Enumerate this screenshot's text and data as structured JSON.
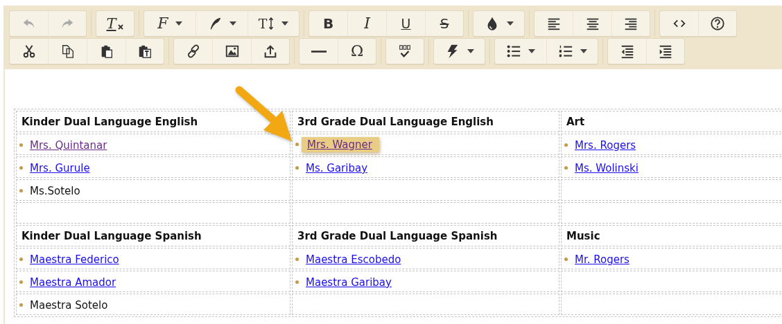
{
  "toolbar": {
    "rows": [
      {
        "groups": [
          {
            "buttons": [
              {
                "kind": "undo",
                "disabled": true,
                "dropdown": false
              },
              {
                "kind": "redo",
                "disabled": true,
                "dropdown": false
              }
            ]
          },
          {
            "buttons": [
              {
                "kind": "clear-format",
                "glyph": "T",
                "disabled": false,
                "dropdown": false
              }
            ]
          },
          {
            "buttons": [
              {
                "kind": "font",
                "glyph": "F",
                "disabled": false,
                "dropdown": true
              },
              {
                "kind": "pen",
                "disabled": false,
                "dropdown": true
              },
              {
                "kind": "font-size",
                "glyph": "T",
                "disabled": false,
                "dropdown": true
              }
            ]
          },
          {
            "buttons": [
              {
                "kind": "bold",
                "glyph": "B",
                "disabled": false,
                "dropdown": false
              },
              {
                "kind": "italic",
                "glyph": "I",
                "disabled": false,
                "dropdown": false
              },
              {
                "kind": "underline",
                "glyph": "U",
                "disabled": false,
                "dropdown": false
              },
              {
                "kind": "strike",
                "glyph": "S",
                "disabled": false,
                "dropdown": false
              }
            ]
          },
          {
            "buttons": [
              {
                "kind": "color",
                "disabled": false,
                "dropdown": true
              }
            ]
          },
          {
            "buttons": [
              {
                "kind": "align-left",
                "disabled": false,
                "dropdown": false
              },
              {
                "kind": "align-center",
                "disabled": false,
                "dropdown": false
              },
              {
                "kind": "align-right",
                "disabled": false,
                "dropdown": false
              }
            ]
          },
          {
            "buttons": [
              {
                "kind": "code",
                "disabled": false,
                "dropdown": false
              },
              {
                "kind": "help",
                "disabled": false,
                "dropdown": false
              }
            ]
          }
        ]
      },
      {
        "groups": [
          {
            "buttons": [
              {
                "kind": "cut",
                "disabled": false,
                "dropdown": false
              },
              {
                "kind": "copy",
                "disabled": false,
                "dropdown": false
              },
              {
                "kind": "paste",
                "disabled": false,
                "dropdown": false
              },
              {
                "kind": "paste-text",
                "disabled": false,
                "dropdown": false
              }
            ]
          },
          {
            "buttons": [
              {
                "kind": "link",
                "disabled": false,
                "dropdown": false
              },
              {
                "kind": "image",
                "disabled": false,
                "dropdown": false
              },
              {
                "kind": "upload",
                "disabled": false,
                "dropdown": false
              }
            ]
          },
          {
            "buttons": [
              {
                "kind": "rule",
                "disabled": false,
                "dropdown": false
              },
              {
                "kind": "special-char",
                "glyph": "Ω",
                "disabled": false,
                "dropdown": false
              }
            ]
          },
          {
            "buttons": [
              {
                "kind": "spellcheck",
                "disabled": false,
                "dropdown": false
              }
            ]
          },
          {
            "buttons": [
              {
                "kind": "lightning",
                "disabled": false,
                "dropdown": true
              }
            ]
          },
          {
            "buttons": [
              {
                "kind": "bullets",
                "disabled": false,
                "dropdown": true
              },
              {
                "kind": "numbered",
                "disabled": false,
                "dropdown": true
              }
            ]
          },
          {
            "buttons": [
              {
                "kind": "outdent",
                "disabled": false,
                "dropdown": false
              },
              {
                "kind": "indent",
                "disabled": false,
                "dropdown": false
              }
            ]
          }
        ]
      }
    ]
  },
  "table": {
    "rows": [
      [
        {
          "kind": "heading",
          "text": "Kinder Dual Language English"
        },
        {
          "kind": "heading",
          "text": "3rd Grade Dual Language English"
        },
        {
          "kind": "heading",
          "text": "Art"
        }
      ],
      [
        {
          "kind": "item",
          "text": "Mrs. Quintanar",
          "link": true,
          "visited": true,
          "highlighted": false
        },
        {
          "kind": "item",
          "text": "Mrs. Wagner",
          "link": true,
          "visited": true,
          "highlighted": true
        },
        {
          "kind": "item",
          "text": "Mrs. Rogers",
          "link": true,
          "visited": false,
          "highlighted": false
        }
      ],
      [
        {
          "kind": "item",
          "text": "Mrs. Gurule",
          "link": true,
          "visited": false,
          "highlighted": false
        },
        {
          "kind": "item",
          "text": "Ms. Garibay",
          "link": true,
          "visited": false,
          "highlighted": false
        },
        {
          "kind": "item",
          "text": "Ms. Wolinski",
          "link": true,
          "visited": false,
          "highlighted": false
        }
      ],
      [
        {
          "kind": "item",
          "text": "Ms.Sotelo",
          "link": false,
          "visited": false,
          "highlighted": false
        },
        {
          "kind": "empty"
        },
        {
          "kind": "empty"
        }
      ],
      [
        {
          "kind": "empty"
        },
        {
          "kind": "empty"
        },
        {
          "kind": "empty"
        }
      ],
      [
        {
          "kind": "heading",
          "text": "Kinder Dual Language Spanish"
        },
        {
          "kind": "heading",
          "text": "3rd Grade Dual Language Spanish"
        },
        {
          "kind": "heading",
          "text": "Music"
        }
      ],
      [
        {
          "kind": "item",
          "text": "Maestra Federico",
          "link": true,
          "visited": false,
          "highlighted": false
        },
        {
          "kind": "item",
          "text": "Maestra Escobedo",
          "link": true,
          "visited": false,
          "highlighted": false
        },
        {
          "kind": "item",
          "text": "Mr. Rogers",
          "link": true,
          "visited": false,
          "highlighted": false
        }
      ],
      [
        {
          "kind": "item",
          "text": "Maestra Amador",
          "link": true,
          "visited": false,
          "highlighted": false
        },
        {
          "kind": "item",
          "text": "Maestra Garibay",
          "link": true,
          "visited": false,
          "highlighted": false
        },
        {
          "kind": "empty"
        }
      ],
      [
        {
          "kind": "item",
          "text": "Maestra Sotelo",
          "link": false,
          "visited": false,
          "highlighted": false
        },
        {
          "kind": "empty"
        },
        {
          "kind": "empty"
        }
      ]
    ]
  }
}
